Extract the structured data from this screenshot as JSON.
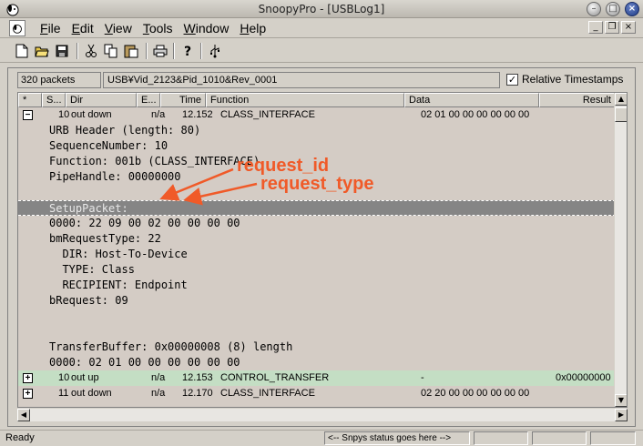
{
  "window": {
    "title": "SnoopyPro - [USBLog1]"
  },
  "menu": [
    {
      "label": "File",
      "u": "F",
      "rest": "ile"
    },
    {
      "label": "Edit",
      "u": "E",
      "rest": "dit"
    },
    {
      "label": "View",
      "u": "V",
      "rest": "iew"
    },
    {
      "label": "Tools",
      "u": "T",
      "rest": "ools"
    },
    {
      "label": "Window",
      "u": "W",
      "rest": "indow"
    },
    {
      "label": "Help",
      "u": "H",
      "rest": "elp"
    }
  ],
  "toolbar": {
    "icons": [
      "new-icon",
      "open-icon",
      "save-icon",
      "cut-icon",
      "copy-icon",
      "paste-icon",
      "print-icon",
      "help-icon",
      "usb-icon"
    ]
  },
  "info": {
    "packet_count": "320 packets",
    "device": "USB¥Vid_2123&Pid_1010&Rev_0001",
    "relative_ts_label": "Relative Timestamps",
    "relative_ts_checked": true
  },
  "columns": [
    "*",
    "S...",
    "Dir",
    "E...",
    "Time",
    "Function",
    "Data",
    "Result"
  ],
  "rows": [
    {
      "exp": "−",
      "seq": "10",
      "dir": "out down",
      "ep": "n/a",
      "time": "12.152",
      "func": "CLASS_INTERFACE",
      "data": "02 01 00 00 00 00 00 00",
      "result": ""
    }
  ],
  "details": [
    "URB Header (length: 80)",
    "SequenceNumber: 10",
    "Function: 001b (CLASS_INTERFACE)",
    "PipeHandle: 00000000",
    "",
    "SetupPacket:",
    "0000: 22 09 00 02 00 00 00 00",
    "bmRequestType: 22",
    "  DIR: Host-To-Device",
    "  TYPE: Class",
    "  RECIPIENT: Endpoint",
    "bRequest: 09",
    "",
    "",
    "TransferBuffer: 0x00000008 (8) length",
    "0000: 02 01 00 00 00 00 00 00"
  ],
  "rows_after": [
    {
      "exp": "+",
      "seq": "10",
      "dir": "out up",
      "ep": "n/a",
      "time": "12.153",
      "func": "CONTROL_TRANSFER",
      "data": "-",
      "result": "0x00000000",
      "green": true
    },
    {
      "exp": "+",
      "seq": "11",
      "dir": "out down",
      "ep": "n/a",
      "time": "12.170",
      "func": "CLASS_INTERFACE",
      "data": "02 20 00 00 00 00 00 00",
      "result": "",
      "green": false
    }
  ],
  "annotations": {
    "request_id": "request_id",
    "request_type": "request_type",
    "color": "#f05a28"
  },
  "status": {
    "ready": "Ready",
    "message": "<-- Snpys status goes here -->"
  }
}
